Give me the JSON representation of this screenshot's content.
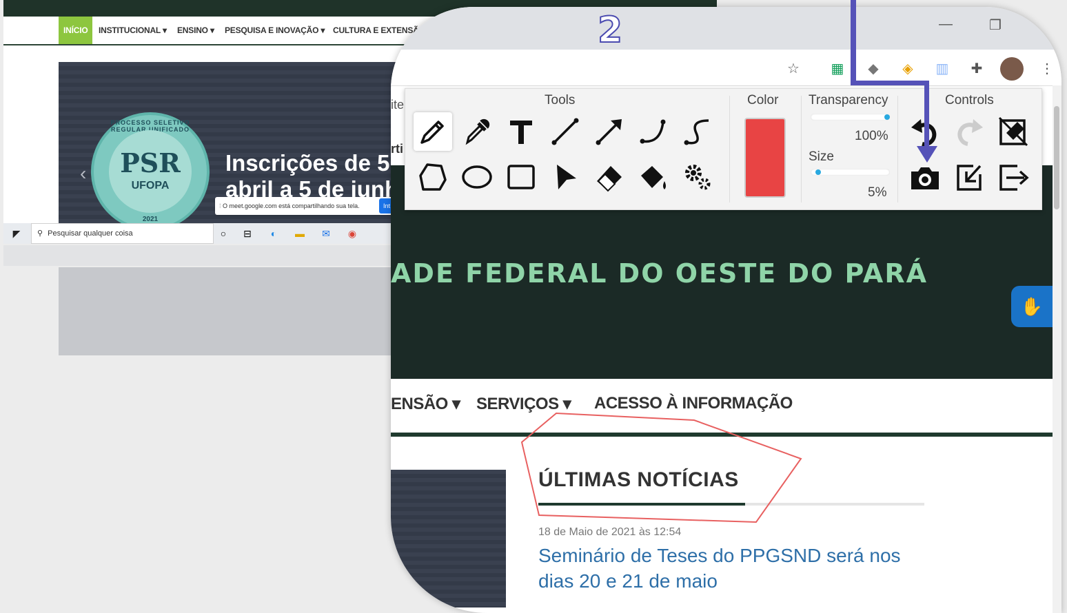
{
  "background_site": {
    "nav": {
      "inicio": "INÍCIO",
      "institucional": "INSTITUCIONAL ▾",
      "ensino": "ENSINO ▾",
      "pesquisa": "PESQUISA E INOVAÇÃO ▾",
      "cultura": "CULTURA E EXTENSÃO ▾"
    },
    "banner": {
      "headline_1": "Inscrições de 5",
      "headline_2": "abril a 5 de junh",
      "seal_main": "PSR",
      "seal_sub": "UFOPA",
      "seal_arc": "PROCESSO SELETIVO REGULAR UNIFICADO",
      "seal_year": "2021"
    },
    "meet_notice": "O meet.google.com está compartilhando sua tela.",
    "meet_button": "Int",
    "taskbar_search_placeholder": "Pesquisar qualquer coisa"
  },
  "badge": "2",
  "toolbar": {
    "tools_title": "Tools",
    "color_title": "Color",
    "transparency_title": "Transparency",
    "transparency_value": "100%",
    "transparency_level": 1.0,
    "size_title": "Size",
    "size_value": "5%",
    "size_level": 0.05,
    "controls_title": "Controls",
    "selected_color": "#e84444"
  },
  "page": {
    "side_partial_1": "ite",
    "side_partial_2": "rti",
    "site_title": "ADE FEDERAL DO OESTE DO PARÁ",
    "nav": {
      "extensao": "ENSÃO ▾",
      "servicos": "SERVIÇOS ▾",
      "acesso": "ACESSO À INFORMAÇÃO"
    },
    "news": {
      "heading": "ÚLTIMAS NOTÍCIAS",
      "date": "18 de Maio de 2021 às 12:54",
      "link": "Seminário de Teses do PPGSND será nos dias 20 e 21 de maio"
    }
  },
  "colors": {
    "pointer_annotation": "#5552b8",
    "polygon_annotation": "#e86060",
    "site_dark": "#1b2a26",
    "site_title": "#8fd4a8"
  }
}
